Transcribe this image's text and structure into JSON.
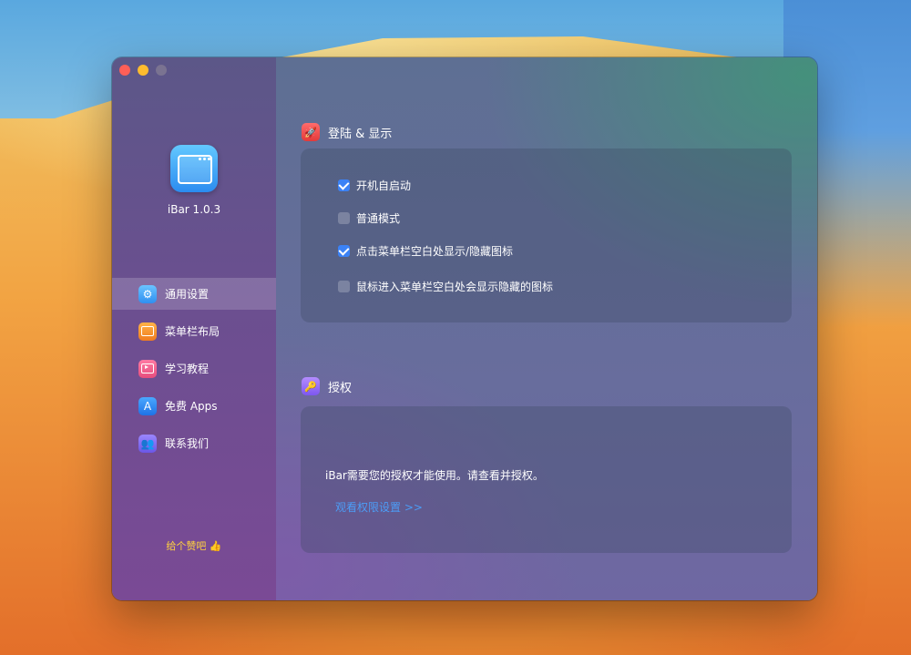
{
  "app": {
    "name_version": "iBar 1.0.3",
    "like_label": "给个赞吧 👍"
  },
  "sidebar": {
    "items": [
      {
        "label": "通用设置",
        "icon": "gear-icon",
        "active": true
      },
      {
        "label": "菜单栏布局",
        "icon": "layout-icon",
        "active": false
      },
      {
        "label": "学习教程",
        "icon": "tutorial-icon",
        "active": false
      },
      {
        "label": "免费 Apps",
        "icon": "app-store-icon",
        "active": false
      },
      {
        "label": "联系我们",
        "icon": "contact-icon",
        "active": false
      }
    ]
  },
  "sections": {
    "display": {
      "title": "登陆 & 显示",
      "options": [
        {
          "label": "开机自启动",
          "checked": true
        },
        {
          "label": "普通模式",
          "checked": false
        },
        {
          "label": "点击菜单栏空白处显示/隐藏图标",
          "checked": true
        },
        {
          "label": "鼠标进入菜单栏空白处会显示隐藏的图标",
          "checked": false
        }
      ]
    },
    "auth": {
      "title": "授权",
      "description": "iBar需要您的授权才能使用。请查看并授权。",
      "link_label": "观看权限设置  >>"
    }
  },
  "colors": {
    "accent": "#3b82f6",
    "link": "#4c9df7",
    "like": "#ffd23f"
  }
}
